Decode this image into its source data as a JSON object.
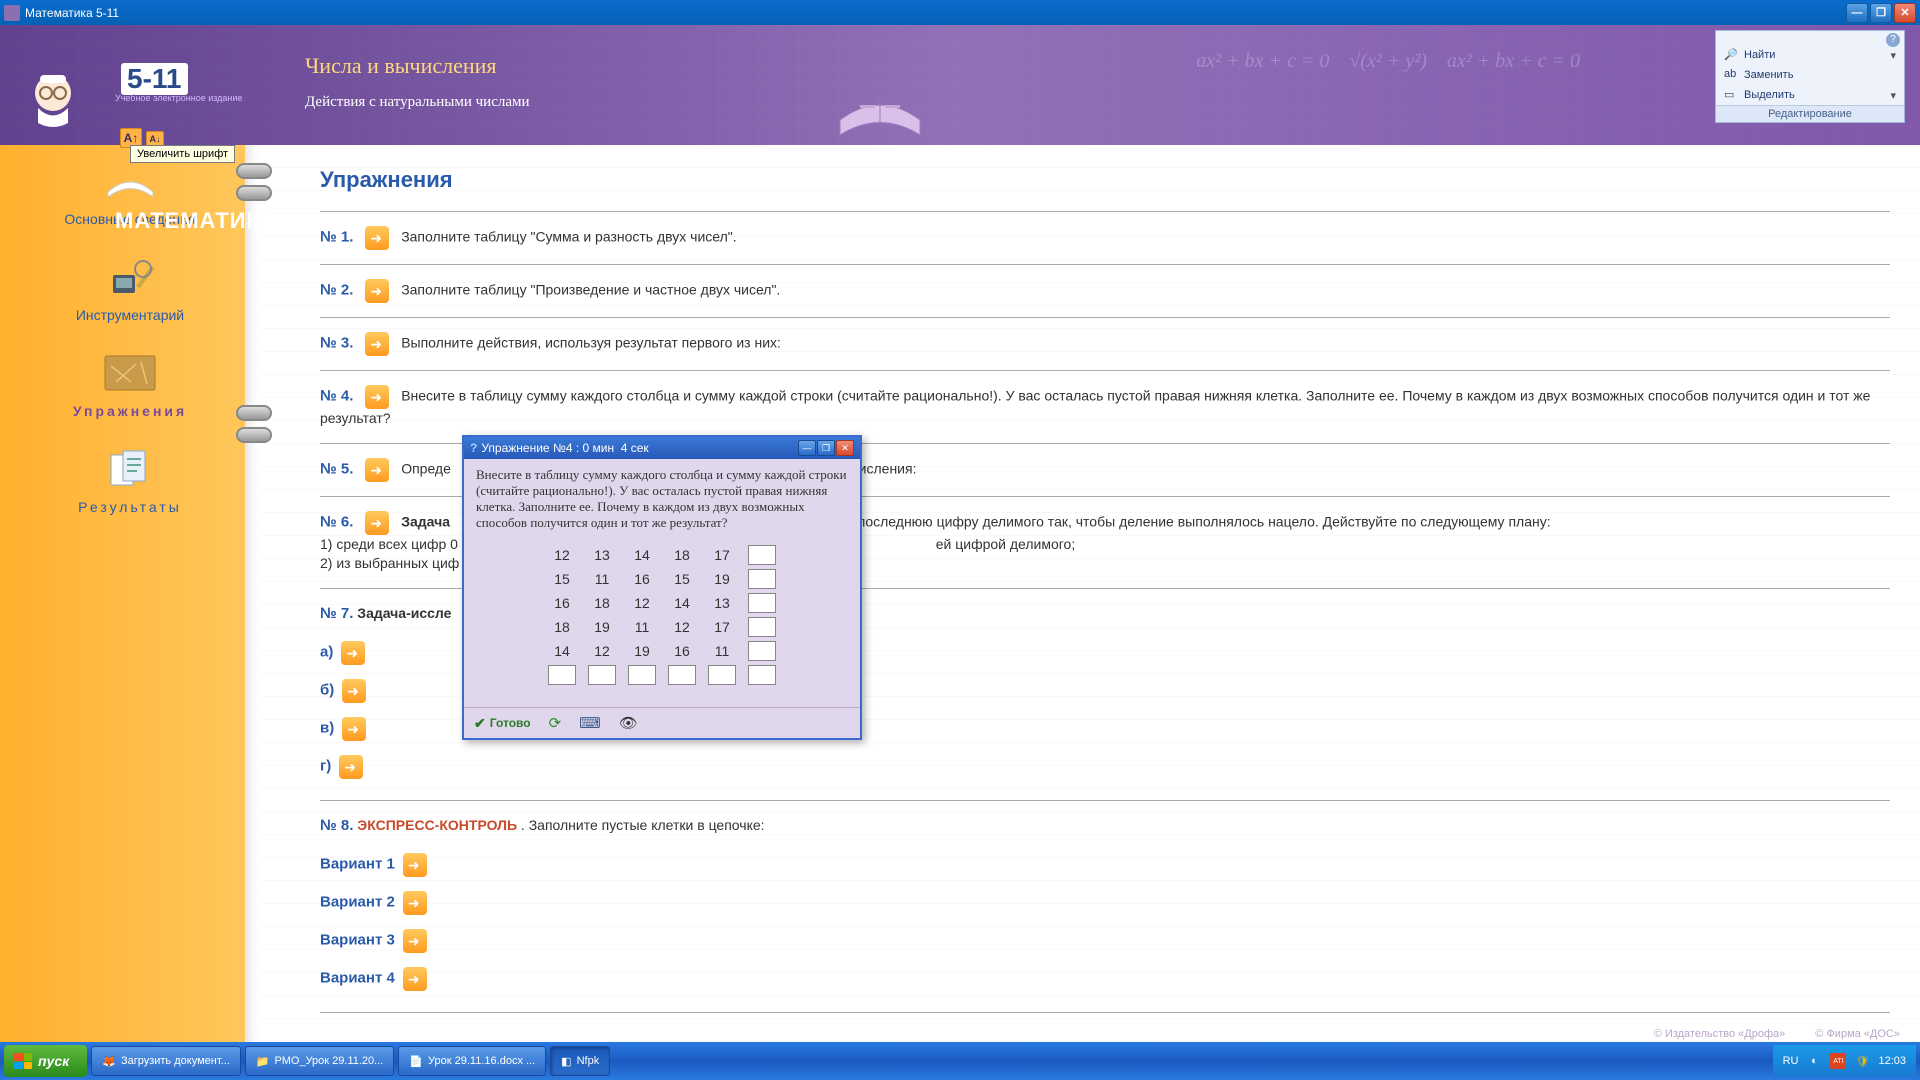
{
  "window": {
    "title": "Математика 5-11"
  },
  "header": {
    "logo_main": "МАТЕМАТИКА",
    "logo_num": "5-11",
    "logo_sub": "Учебное электронное издание",
    "title": "Числа и вычисления",
    "subtitle": "Действия с натуральными числами",
    "font_tooltip": "Увеличить шрифт"
  },
  "ribbon": {
    "find": "Найти",
    "replace": "Заменить",
    "select": "Выделить",
    "group": "Редактирование"
  },
  "sidebar": {
    "items": [
      {
        "label": "Основные сведения"
      },
      {
        "label": "Инструментарий"
      },
      {
        "label": "Упражнения"
      },
      {
        "label": "Результаты"
      }
    ]
  },
  "content": {
    "title": "Упражнения",
    "exercises": [
      {
        "num": "№ 1.",
        "text": "Заполните таблицу \"Сумма и разность двух чисел\"."
      },
      {
        "num": "№ 2.",
        "text": "Заполните таблицу \"Произведение и частное двух чисел\"."
      },
      {
        "num": "№ 3.",
        "text": "Выполните действия, используя результат первого из них:"
      },
      {
        "num": "№ 4.",
        "text": "Внесите в таблицу сумму каждого столбца и сумму каждой строки (считайте рационально!). У вас осталась пустой правая нижняя клетка. Заполните ее. Почему в каждом из двух возможных способов получится один и тот же результат?"
      },
      {
        "num": "№ 5.",
        "text_pre": "Опреде",
        "text_post": "исления:"
      },
      {
        "num": "№ 6.",
        "bold": "Задача",
        "text_post": " последнюю цифру делимого так, чтобы деление выполнялось нацело. Действуйте по следующему плану:",
        "lines": [
          "1) среди всех цифр 0",
          "ей цифрой делимого;",
          "2) из выбранных циф"
        ]
      },
      {
        "num": "№ 7.",
        "bold": "Задача-иссле"
      },
      {
        "num": "№ 8.",
        "highlight": "ЭКСПРЕСС-КОНТРОЛЬ",
        "text": ". Заполните пустые клетки в цепочке:"
      }
    ],
    "subs": [
      "а)",
      "б)",
      "в)",
      "г)"
    ],
    "variants": [
      "Вариант 1",
      "Вариант 2",
      "Вариант 3",
      "Вариант 4"
    ]
  },
  "modal": {
    "title": "Упражнение №4 : 0 мин  4 сек",
    "body": "Внесите в таблицу сумму каждого столбца и сумму каждой строки (считайте рационально!). У вас осталась пустой правая нижняя клетка. Заполните ее. Почему в каждом из двух возможных способов получится один и тот же результат?",
    "table": [
      [
        "12",
        "13",
        "14",
        "18",
        "17"
      ],
      [
        "15",
        "11",
        "16",
        "15",
        "19"
      ],
      [
        "16",
        "18",
        "12",
        "14",
        "13"
      ],
      [
        "18",
        "19",
        "11",
        "12",
        "17"
      ],
      [
        "14",
        "12",
        "19",
        "16",
        "11"
      ]
    ],
    "done": "Готово"
  },
  "footer": {
    "credits": [
      "© Издательство «Дрофа»",
      "© Фирма «ДОС»"
    ]
  },
  "taskbar": {
    "start": "пуск",
    "items": [
      "Загрузить документ...",
      "РМО_Урок 29.11.20...",
      "Урок 29.11.16.docx ...",
      "Nfpk"
    ],
    "lang": "RU",
    "time": "12:03"
  }
}
